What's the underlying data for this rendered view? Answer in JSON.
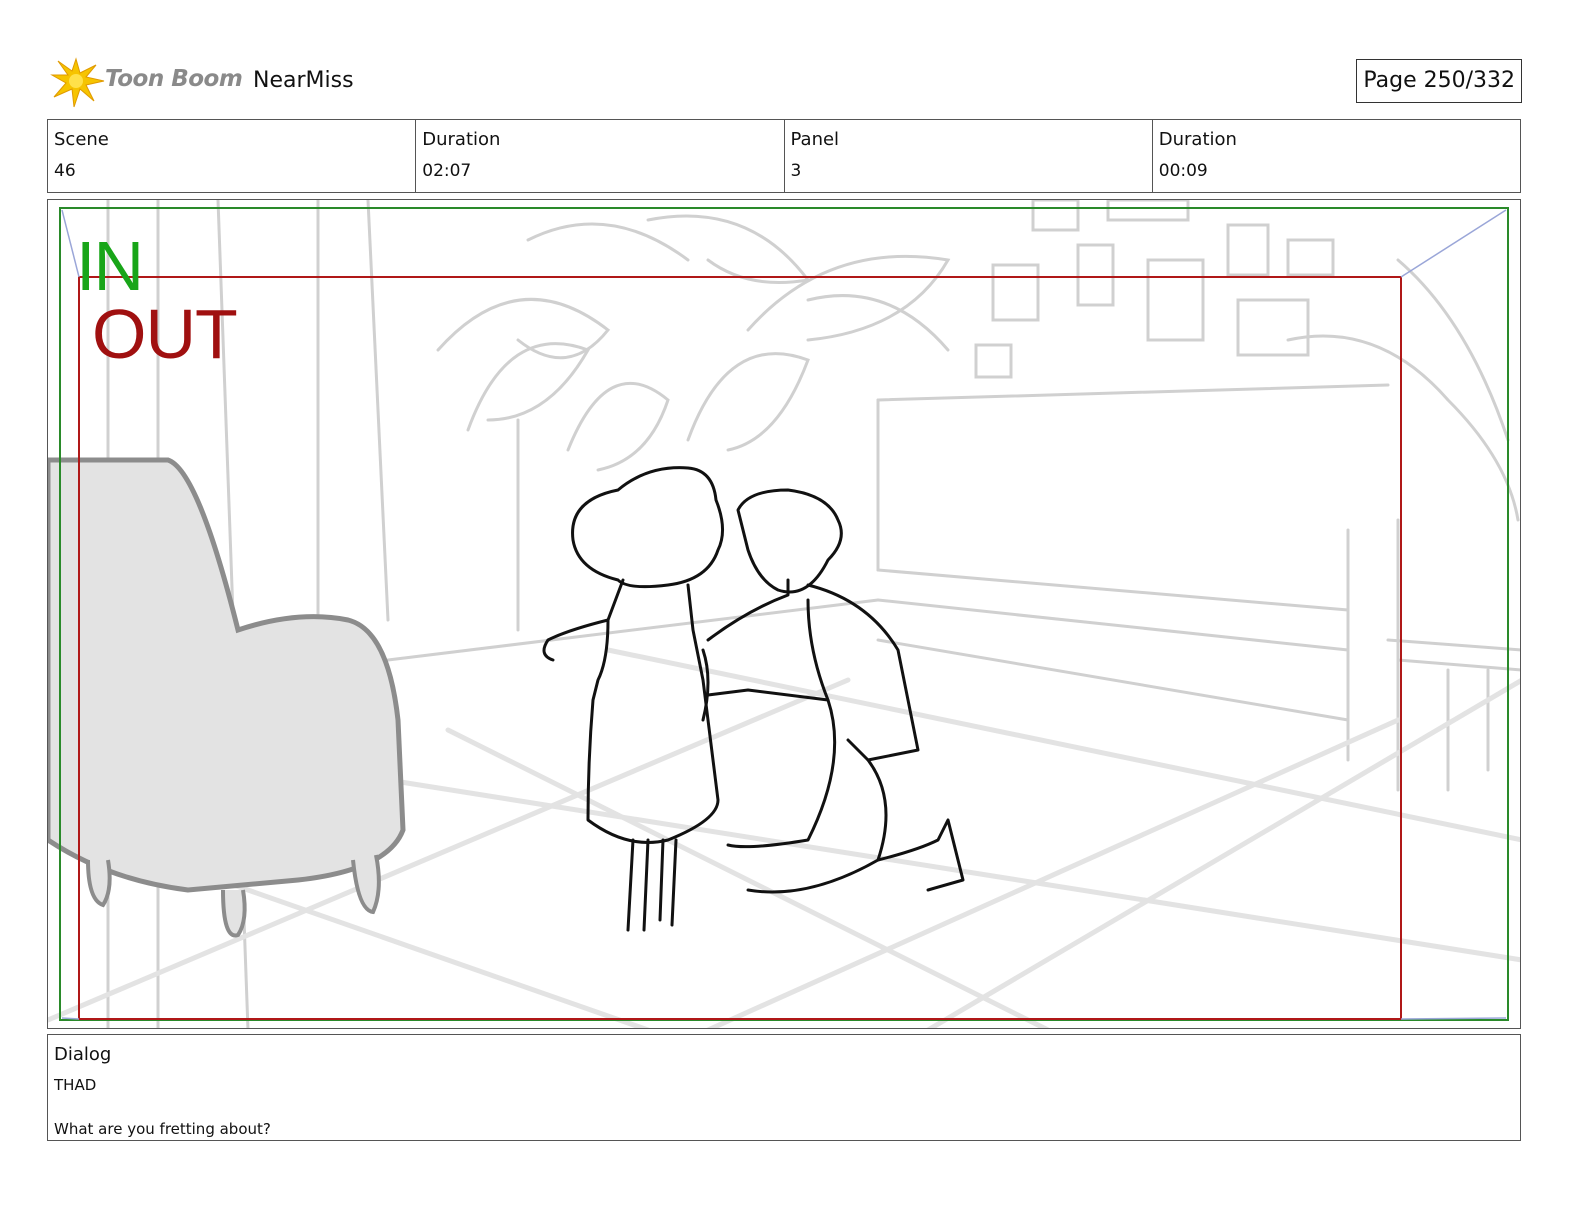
{
  "header": {
    "logo_text": "Toon Boom",
    "project_name": "NearMiss",
    "page_label": "Page 250/332"
  },
  "info": {
    "scene_label": "Scene",
    "scene_value": "46",
    "scene_duration_label": "Duration",
    "scene_duration_value": "02:07",
    "panel_label": "Panel",
    "panel_value": "3",
    "panel_duration_label": "Duration",
    "panel_duration_value": "00:09"
  },
  "frame": {
    "in_label": "IN",
    "out_label": "OUT",
    "in_color": "#18a518",
    "out_color": "#a01010"
  },
  "dialog": {
    "label": "Dialog",
    "character": "THAD",
    "line": "What are you fretting about?"
  }
}
